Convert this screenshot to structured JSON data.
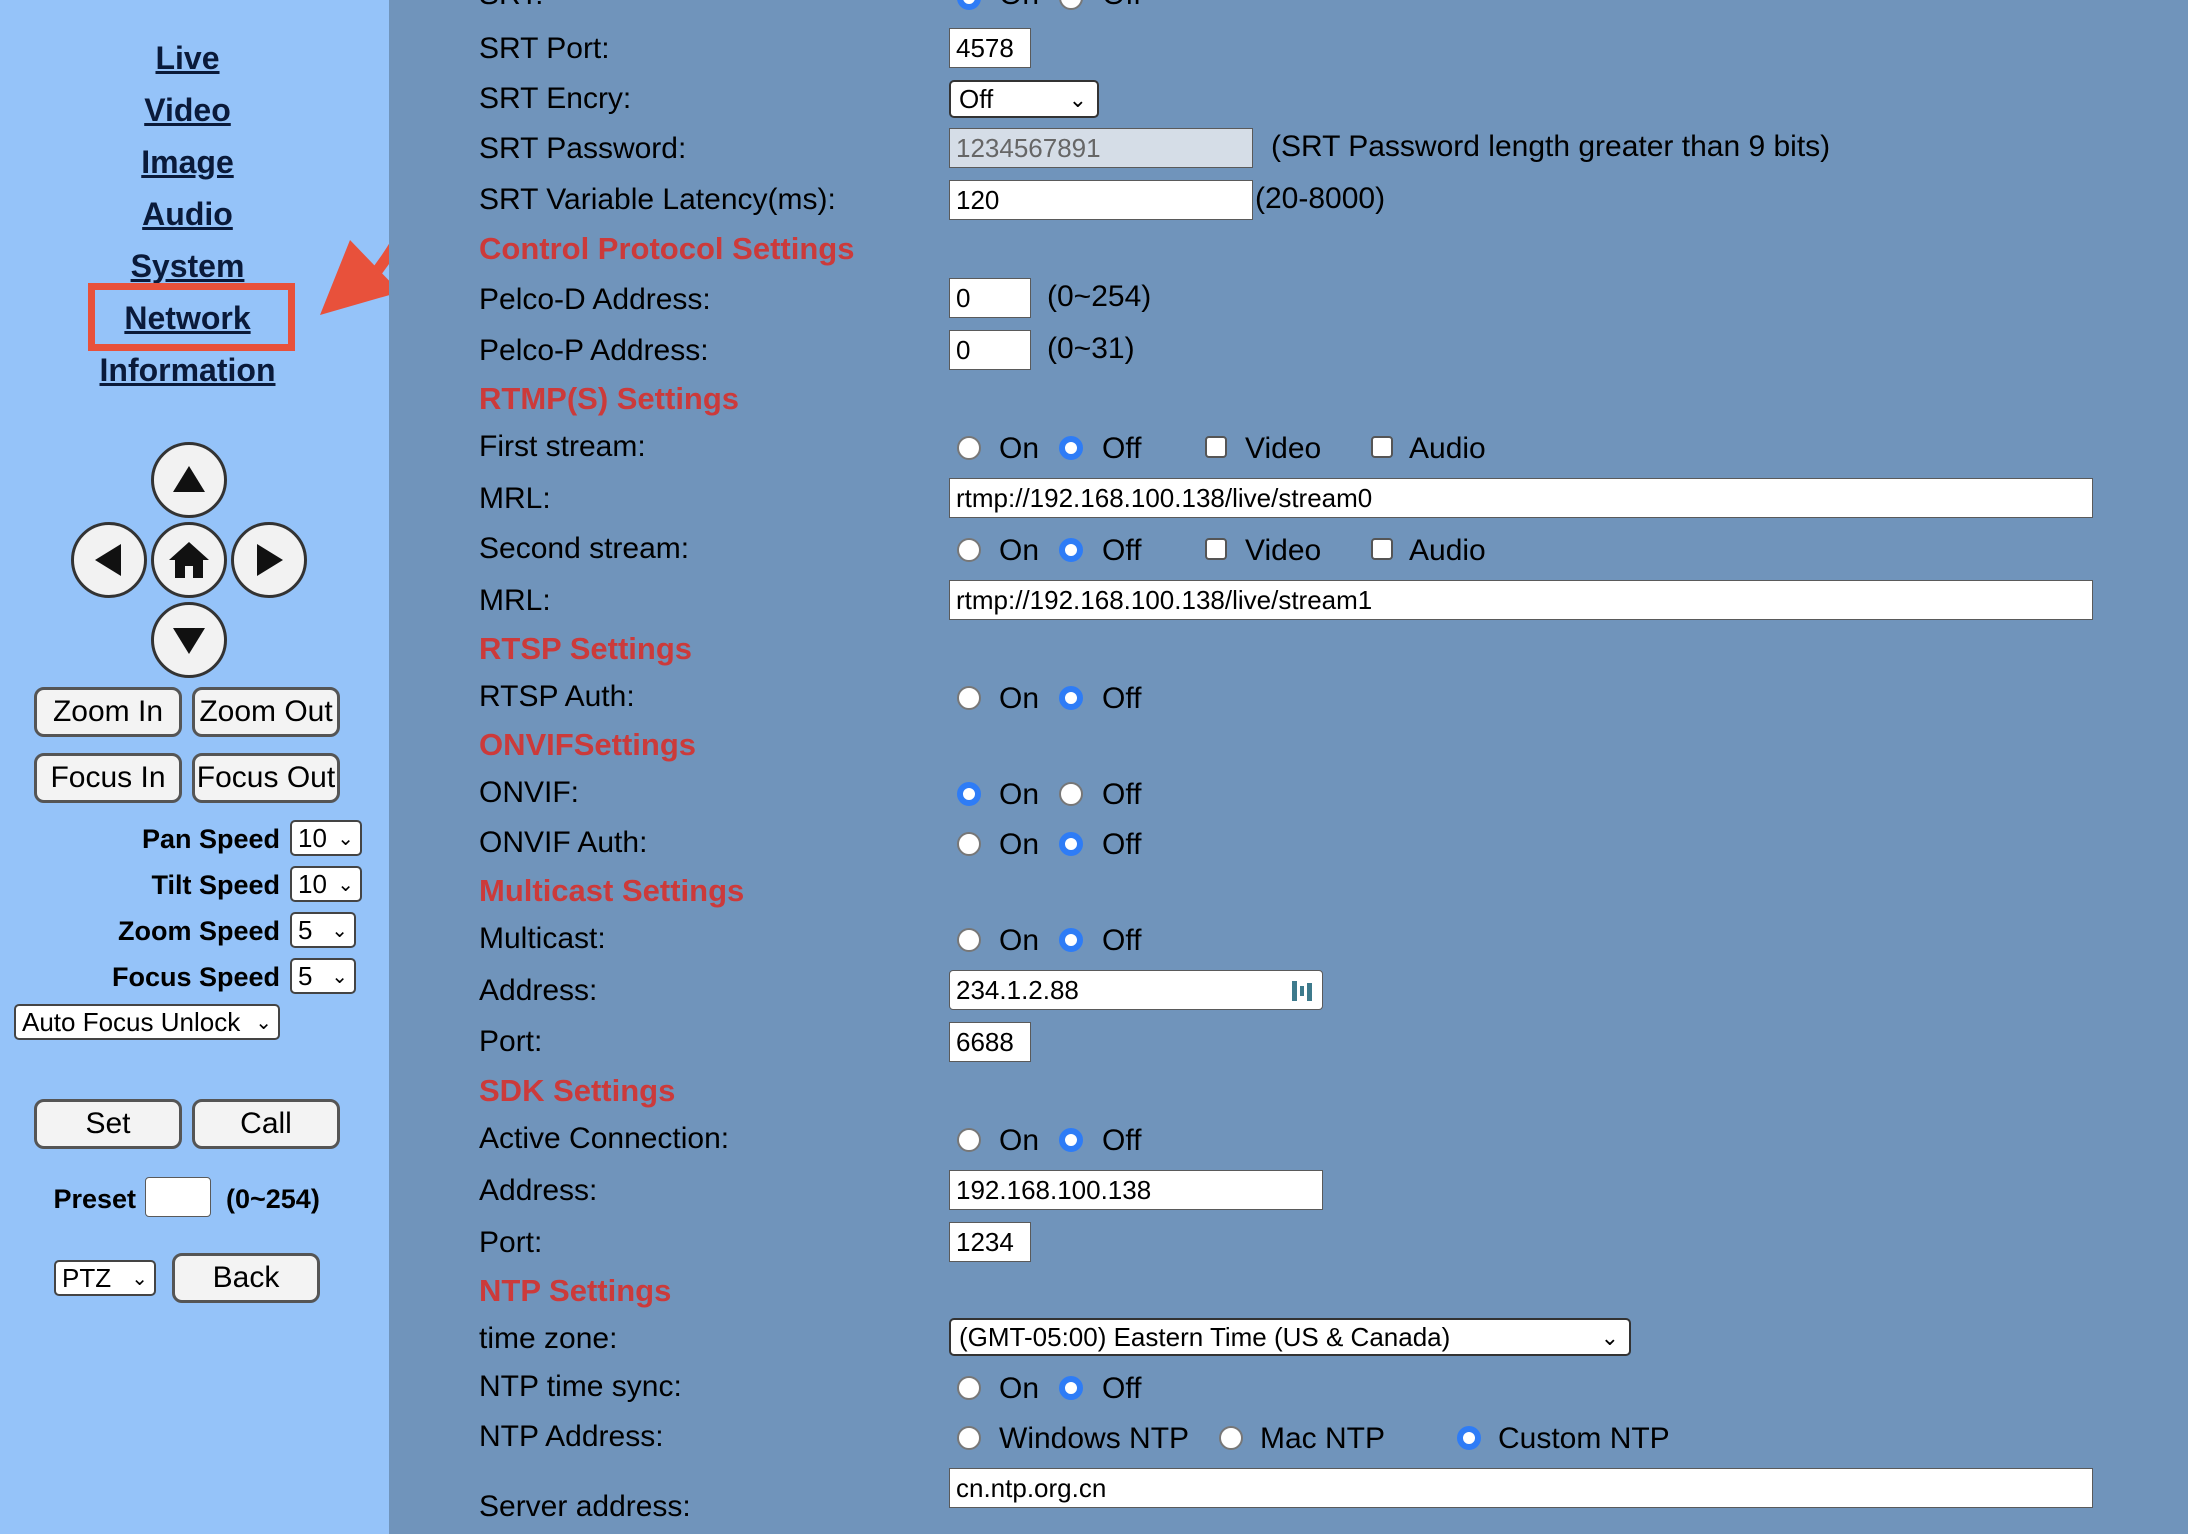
{
  "nav": {
    "live": "Live",
    "video": "Video",
    "image": "Image",
    "audio": "Audio",
    "system": "System",
    "network": "Network",
    "information": "Information"
  },
  "ptz": {
    "zoom_in": "Zoom In",
    "zoom_out": "Zoom Out",
    "focus_in": "Focus In",
    "focus_out": "Focus Out",
    "pan_speed_label": "Pan Speed",
    "pan_speed": "10",
    "tilt_speed_label": "Tilt Speed",
    "tilt_speed": "10",
    "zoom_speed_label": "Zoom Speed",
    "zoom_speed": "5",
    "focus_speed_label": "Focus Speed",
    "focus_speed": "5",
    "focus_mode": "Auto Focus Unlock",
    "set": "Set",
    "call": "Call",
    "preset_label": "Preset",
    "preset_value": "",
    "preset_range": "(0~254)",
    "mode": "PTZ",
    "back": "Back"
  },
  "srt": {
    "srt_cut_label": "SRT:",
    "on": "On",
    "off": "Off",
    "port_label": "SRT Port:",
    "port": "4578",
    "encry_label": "SRT Encry:",
    "encry": "Off",
    "password_label": "SRT Password:",
    "password": "1234567891",
    "password_note": "(SRT Password length greater than 9 bits)",
    "latency_label": "SRT Variable Latency(ms):",
    "latency": "120",
    "latency_note": "(20-8000)"
  },
  "control": {
    "title": "Control Protocol Settings",
    "pelco_d_label": "Pelco-D Address:",
    "pelco_d": "0",
    "pelco_d_range": "(0~254)",
    "pelco_p_label": "Pelco-P Address:",
    "pelco_p": "0",
    "pelco_p_range": "(0~31)"
  },
  "rtmp": {
    "title": "RTMP(S) Settings",
    "first_label": "First stream:",
    "mrl_label": "MRL:",
    "mrl1": "rtmp://192.168.100.138/live/stream0",
    "second_label": "Second stream:",
    "mrl2": "rtmp://192.168.100.138/live/stream1",
    "on": "On",
    "off": "Off",
    "video": "Video",
    "audio": "Audio"
  },
  "rtsp": {
    "title": "RTSP Settings",
    "auth_label": "RTSP Auth:",
    "on": "On",
    "off": "Off"
  },
  "onvif": {
    "title": "ONVIFSettings",
    "onvif_label": "ONVIF:",
    "auth_label": "ONVIF Auth:",
    "on": "On",
    "off": "Off"
  },
  "multicast": {
    "title": "Multicast Settings",
    "multicast_label": "Multicast:",
    "on": "On",
    "off": "Off",
    "address_label": "Address:",
    "address": "234.1.2.88",
    "port_label": "Port:",
    "port": "6688"
  },
  "sdk": {
    "title": "SDK Settings",
    "active_label": "Active Connection:",
    "on": "On",
    "off": "Off",
    "address_label": "Address:",
    "address": "192.168.100.138",
    "port_label": "Port:",
    "port": "1234"
  },
  "ntp": {
    "title": "NTP Settings",
    "timezone_label": "time zone:",
    "timezone": "(GMT-05:00) Eastern Time (US & Canada)",
    "sync_label": "NTP time sync:",
    "on": "On",
    "off": "Off",
    "address_label": "NTP Address:",
    "windows": "Windows NTP",
    "mac": "Mac NTP",
    "custom": "Custom NTP",
    "server_label": "Server address:",
    "server": "cn.ntp.org.cn"
  },
  "colors": {
    "sidebar": "#95c3f9",
    "main": "#7094bb",
    "section": "#cc3a3a",
    "highlight": "#e8513b",
    "radio": "#2e7cf6"
  }
}
